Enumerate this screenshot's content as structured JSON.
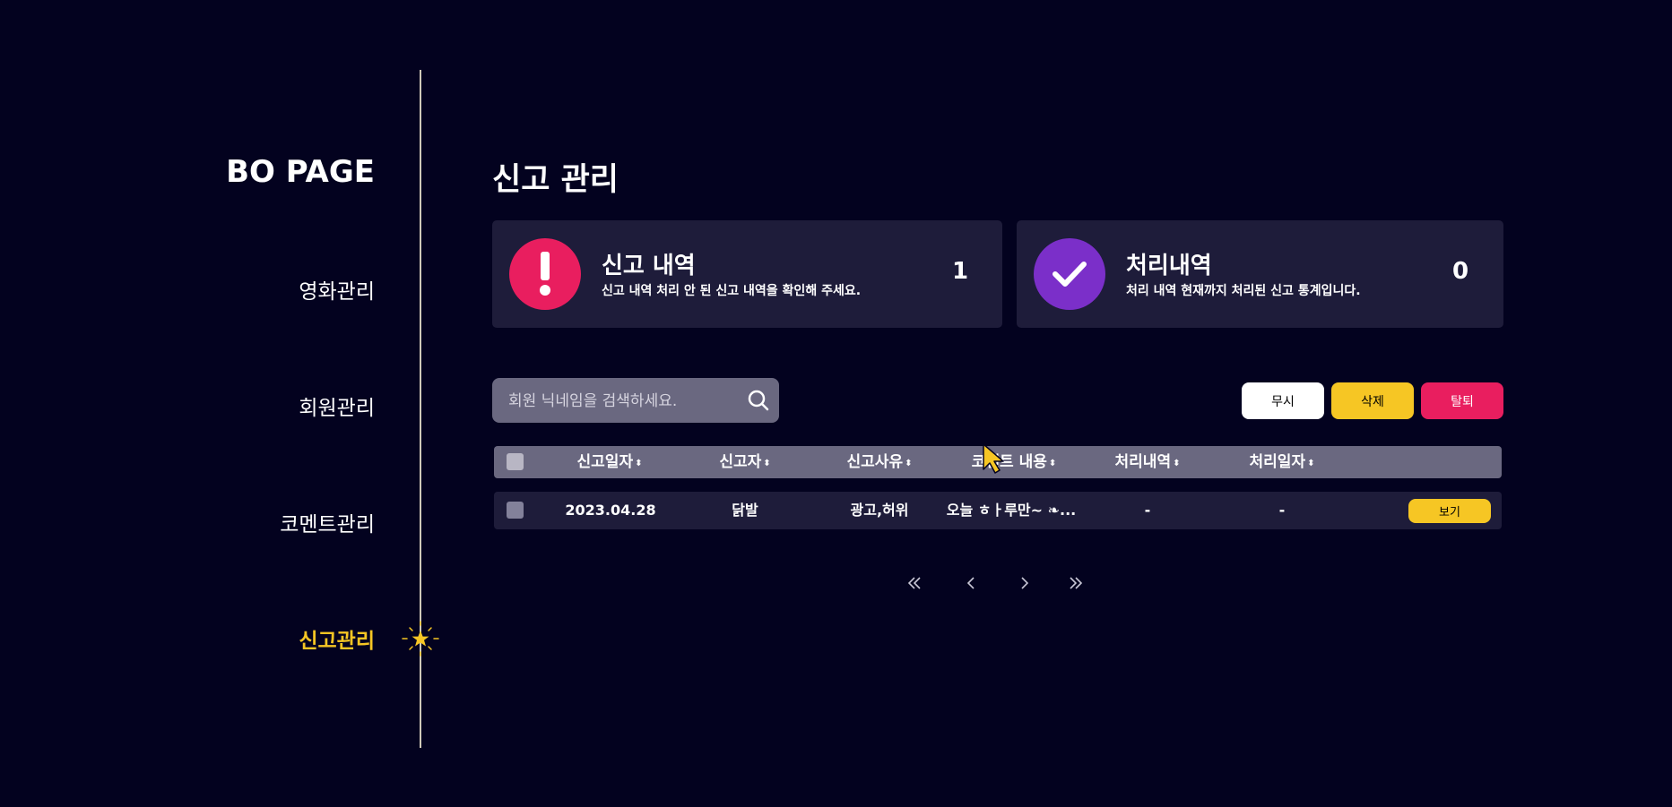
{
  "sidebar": {
    "brand": "BO PAGE",
    "items": [
      {
        "label": "영화관리",
        "active": false
      },
      {
        "label": "회원관리",
        "active": false
      },
      {
        "label": "코멘트관리",
        "active": false
      },
      {
        "label": "신고관리",
        "active": true
      }
    ],
    "active_icon": "star-icon"
  },
  "main": {
    "title": "신고 관리",
    "cards": [
      {
        "title": "신고 내역",
        "desc": "신고 내역 처리 안 된 신고 내역을 확인해 주세요.",
        "count": "1",
        "icon": "exclamation-icon",
        "icon_color": "#e91e5f"
      },
      {
        "title": "처리내역",
        "desc": "처리 내역 현재까지 처리된 신고 통계입니다.",
        "count": "0",
        "icon": "checkmark-icon",
        "icon_color": "#7b2fc9"
      }
    ],
    "search": {
      "placeholder": "회원 닉네임을 검색하세요.",
      "value": "",
      "icon": "search-icon"
    },
    "actions": {
      "ignore": "무시",
      "delete": "삭제",
      "withdraw": "탈퇴"
    },
    "table": {
      "columns": [
        "신고일자",
        "신고자",
        "신고사유",
        "코멘트 내용",
        "처리내역",
        "처리일자"
      ],
      "sort_glyph": "⬍",
      "rows": [
        {
          "date": "2023.04.28",
          "reporter": "닭발",
          "reason": "광고,허위",
          "content": "오늘 ㅎㅏ루만~ ❧...",
          "status": "-",
          "processed_date": "-",
          "action": "보기"
        }
      ]
    },
    "pagination": [
      "first-page-icon",
      "prev-page-icon",
      "next-page-icon",
      "last-page-icon"
    ]
  },
  "colors": {
    "background": "#03021f",
    "card": "#1e1c3a",
    "accent_yellow": "#f6c624",
    "accent_pink": "#e91e5f",
    "accent_purple": "#7b2fc9",
    "header_gray": "#6a6880"
  }
}
